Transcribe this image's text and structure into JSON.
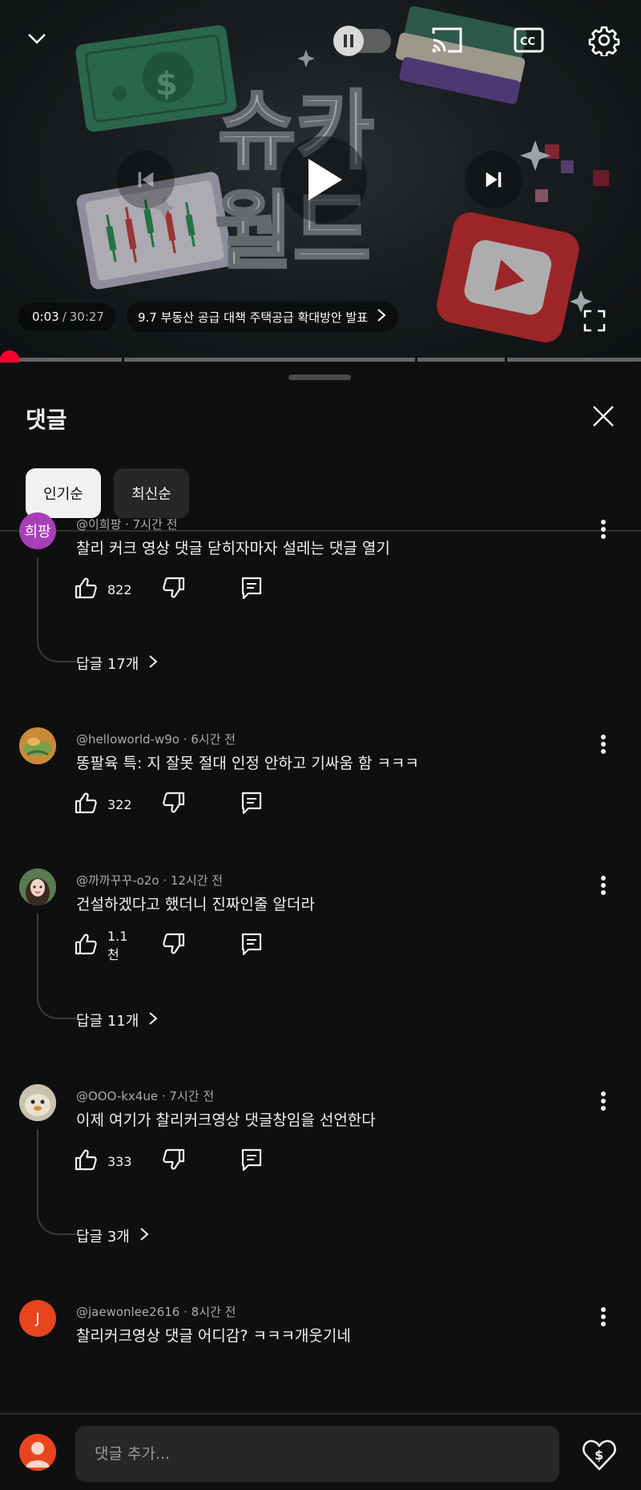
{
  "player": {
    "current_time": "0:03",
    "separator": "/",
    "duration": "30:27",
    "chapter_title": "9.7 부동산 공급 대책 주택공급 확대방안 발표",
    "progress_fraction": 0.002,
    "thumbnail_text": [
      "슈카",
      "월드"
    ]
  },
  "panel": {
    "title": "댓글",
    "sort_chips": [
      {
        "label": "인기순",
        "selected": true
      },
      {
        "label": "최신순",
        "selected": false
      }
    ]
  },
  "comments": [
    {
      "author": "@이희팡",
      "time": "7시간 전",
      "text": "찰리 커크 영상 댓글 닫히자마자 설레는 댓글 열기",
      "likes": "822",
      "avatar_type": "initials",
      "avatar_text": "희팡",
      "avatar_color": "#a83fb8",
      "replies": "답글 17개"
    },
    {
      "author": "@helloworld-w9o",
      "time": "6시간 전",
      "text": "똥팔육 특: 지 잘못 절대 인정 안하고 기싸움 함 ㅋㅋㅋ",
      "likes": "322",
      "avatar_type": "image",
      "avatar_color": "#c98a3a",
      "replies": null
    },
    {
      "author": "@까까꾸꾸-o2o",
      "time": "12시간 전",
      "text": "건설하겠다고 했더니 진짜인줄 알더라",
      "likes": "1.1천",
      "avatar_type": "image",
      "avatar_color": "#5a7a52",
      "replies": "답글 11개"
    },
    {
      "author": "@OOO-kx4ue",
      "time": "7시간 전",
      "text": "이제 여기가 찰리커크영상 댓글창임을 선언한다",
      "likes": "333",
      "avatar_type": "image",
      "avatar_color": "#c9c2ad",
      "replies": "답글 3개"
    },
    {
      "author": "@jaewonlee2616",
      "time": "8시간 전",
      "text": "찰리커크영상 댓글 어디감? ㅋㅋㅋ개웃기네",
      "likes": "",
      "avatar_type": "initials",
      "avatar_text": "J",
      "avatar_color": "#e8451f",
      "replies": null
    }
  ],
  "bottom_bar": {
    "placeholder": "댓글 추가..."
  },
  "colors": {
    "background": "#0f0f0f",
    "chip_active": "#f1f1f1",
    "chip_idle": "#272727",
    "progress": "#ff0033"
  },
  "icons": {
    "collapse": "chevron-down-icon",
    "autoplay": "pause-icon",
    "cast": "cast-icon",
    "captions": "cc-icon",
    "settings": "gear-icon",
    "previous": "skip-previous-icon",
    "play": "play-icon",
    "next": "skip-next-icon",
    "fullscreen": "fullscreen-icon",
    "close": "close-icon",
    "like": "thumb-up-icon",
    "dislike": "thumb-down-icon",
    "reply": "comment-icon",
    "more": "more-vert-icon",
    "chevron": "chevron-right-icon",
    "thanks": "super-thanks-icon"
  }
}
